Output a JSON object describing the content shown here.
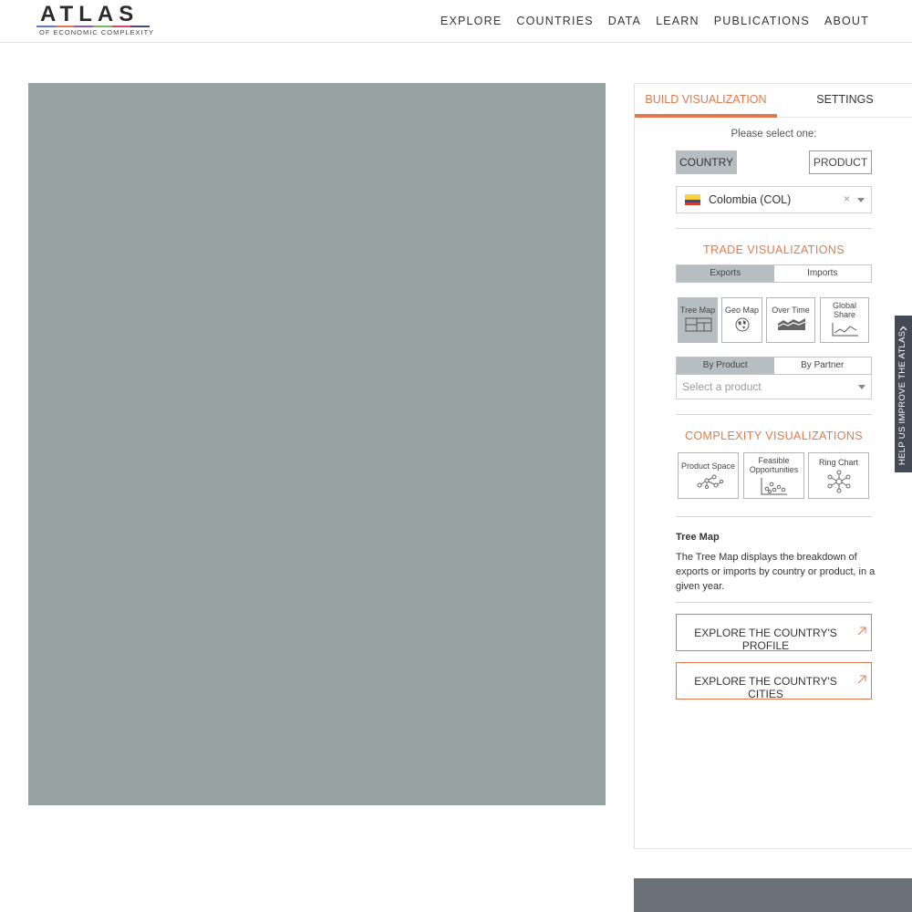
{
  "header": {
    "logo": {
      "word": "ATLAS",
      "subtitle": "OF ECONOMIC COMPLEXITY",
      "bar_colors": [
        "#5b7bb9",
        "#e07a4d",
        "#8a5aa8",
        "#7fb069",
        "#d6456b",
        "#3f4e6e"
      ]
    },
    "nav": [
      "EXPLORE",
      "COUNTRIES",
      "DATA",
      "LEARN",
      "PUBLICATIONS",
      "ABOUT"
    ]
  },
  "canvas": {
    "color": "#97a3a3"
  },
  "panel": {
    "tabs": {
      "build": "BUILD VISUALIZATION",
      "settings": "SETTINGS"
    },
    "prompt": "Please select one:",
    "type_buttons": {
      "country": "COUNTRY",
      "product": "PRODUCT"
    },
    "country_select": {
      "value": "Colombia (COL)",
      "clear": "×"
    },
    "trade": {
      "title": "TRADE VISUALIZATIONS",
      "flow": {
        "exports": "Exports",
        "imports": "Imports"
      },
      "viz": {
        "tree_map": "Tree Map",
        "geo_map": "Geo Map",
        "over_time": "Over Time",
        "global_share_1": "Global",
        "global_share_2": "Share"
      },
      "by": {
        "product": "By Product",
        "partner": "By Partner"
      },
      "product_placeholder": "Select a product"
    },
    "complexity": {
      "title": "COMPLEXITY VISUALIZATIONS",
      "product_space": "Product Space",
      "feasible_1": "Feasible",
      "feasible_2": "Opportunities",
      "ring_chart": "Ring Chart"
    },
    "description": {
      "title": "Tree Map",
      "text": "The Tree Map displays the breakdown of exports or imports by country or product, in a given year."
    },
    "explore": {
      "profile": "EXPLORE THE COUNTRY'S PROFILE",
      "cities": "EXPLORE THE COUNTRY'S CITIES"
    }
  },
  "help_tab": {
    "label": "HELP US IMPROVE THE ATLAS"
  },
  "colors": {
    "accent": "#e07a4d",
    "active_fill": "#b7bec1",
    "help_tab": "#434a55",
    "footer": "#6a7077"
  }
}
